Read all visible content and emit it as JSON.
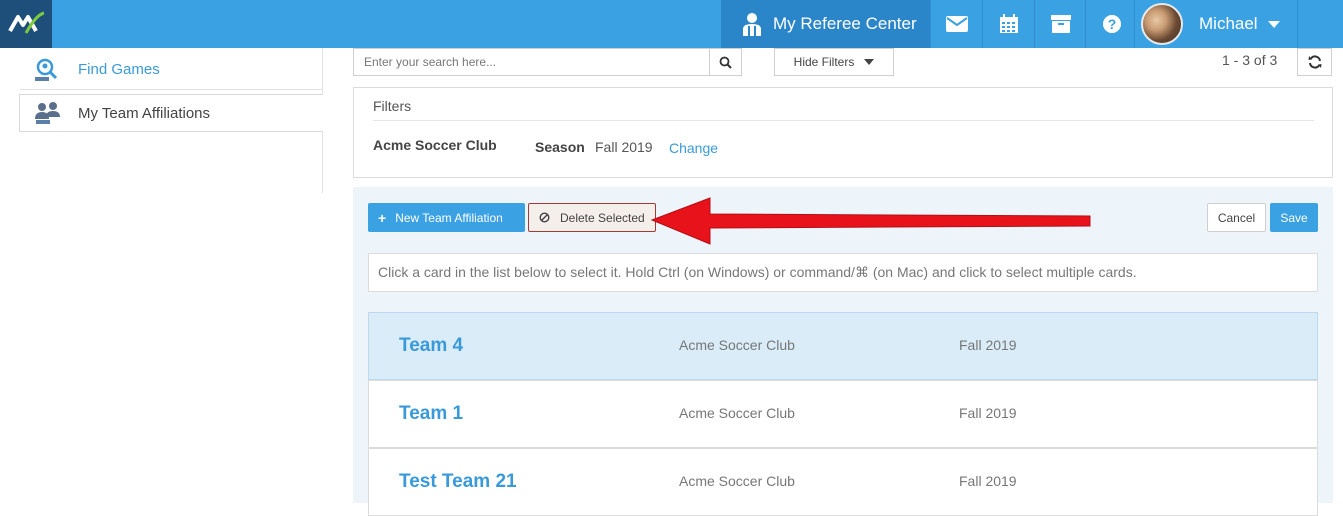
{
  "header": {
    "referee_center_label": "My Referee Center",
    "user_name": "Michael"
  },
  "sidebar": {
    "items": [
      {
        "label": "Find Games",
        "icon": "search-people-icon"
      },
      {
        "label": "My Team Affiliations",
        "icon": "team-icon"
      }
    ]
  },
  "search": {
    "placeholder": "Enter your search here..."
  },
  "toolbar": {
    "hide_filters_label": "Hide Filters",
    "pager_text": "1 - 3 of 3"
  },
  "filters": {
    "title": "Filters",
    "club": "Acme Soccer Club",
    "season_label": "Season",
    "season_value": "Fall 2019",
    "change_label": "Change"
  },
  "actions": {
    "new_label": "New Team Affiliation",
    "delete_label": "Delete Selected",
    "cancel_label": "Cancel",
    "save_label": "Save"
  },
  "hint": "Click a card in the list below to select it. Hold Ctrl (on Windows) or command/⌘ (on Mac) and click to select multiple cards.",
  "teams": [
    {
      "name": "Team 4",
      "club": "Acme Soccer Club",
      "season": "Fall 2019",
      "selected": true
    },
    {
      "name": "Team 1",
      "club": "Acme Soccer Club",
      "season": "Fall 2019",
      "selected": false
    },
    {
      "name": "Test Team 21",
      "club": "Acme Soccer Club",
      "season": "Fall 2019",
      "selected": false
    }
  ],
  "colors": {
    "brand_blue": "#3aa1e2",
    "header_dark": "#2b85c9",
    "logo_bg": "#1d4f7a",
    "selected_card": "#d9ecf8",
    "annotation_arrow": "#e8121b"
  }
}
